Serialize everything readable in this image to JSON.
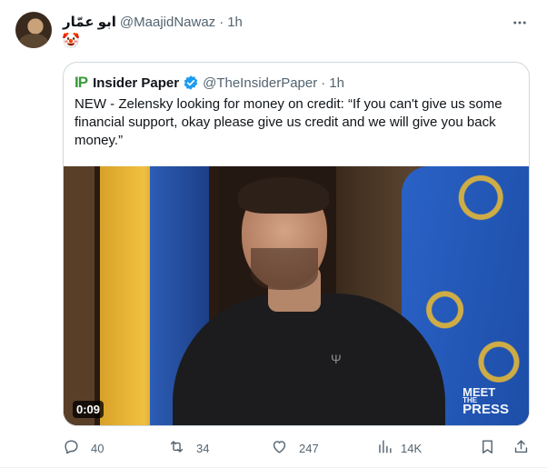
{
  "tweet": {
    "author_name": "ابو عمّار",
    "author_handle": "@MaajidNawaz",
    "separator": "·",
    "time": "1h",
    "emoji": "🤡",
    "more_icon": "more-horizontal-icon"
  },
  "quote": {
    "logo": "IP",
    "name": "Insider Paper",
    "handle": "@TheInsiderPaper",
    "separator": "·",
    "time": "1h",
    "text": "NEW - Zelensky looking for money on credit: “If you can't give us some financial support, okay please give us credit and we will give you back money.”",
    "video": {
      "duration": "0:09",
      "watermark_line1": "MEET",
      "watermark_line2": "THE",
      "watermark_line3": "PRESS"
    }
  },
  "actions": {
    "reply_count": "40",
    "retweet_count": "34",
    "like_count": "247",
    "view_count": "14K"
  },
  "colors": {
    "secondary_text": "#536471",
    "border": "#cfd9de",
    "verified_blue": "#1d9bf0"
  }
}
